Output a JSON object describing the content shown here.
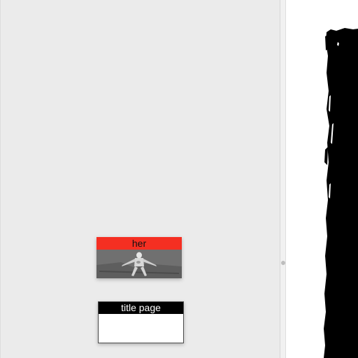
{
  "board": {
    "cards": [
      {
        "title": "her",
        "header_color": "#f52f22",
        "thumbnail": "figure-photo"
      },
      {
        "title": "title page",
        "header_color": "#000000"
      }
    ]
  },
  "preview": {
    "content": "brush-stroke-image"
  },
  "colors": {
    "board_bg": "#ebebeb",
    "accent_red": "#f52f22",
    "preview_bg": "#ffffff"
  }
}
